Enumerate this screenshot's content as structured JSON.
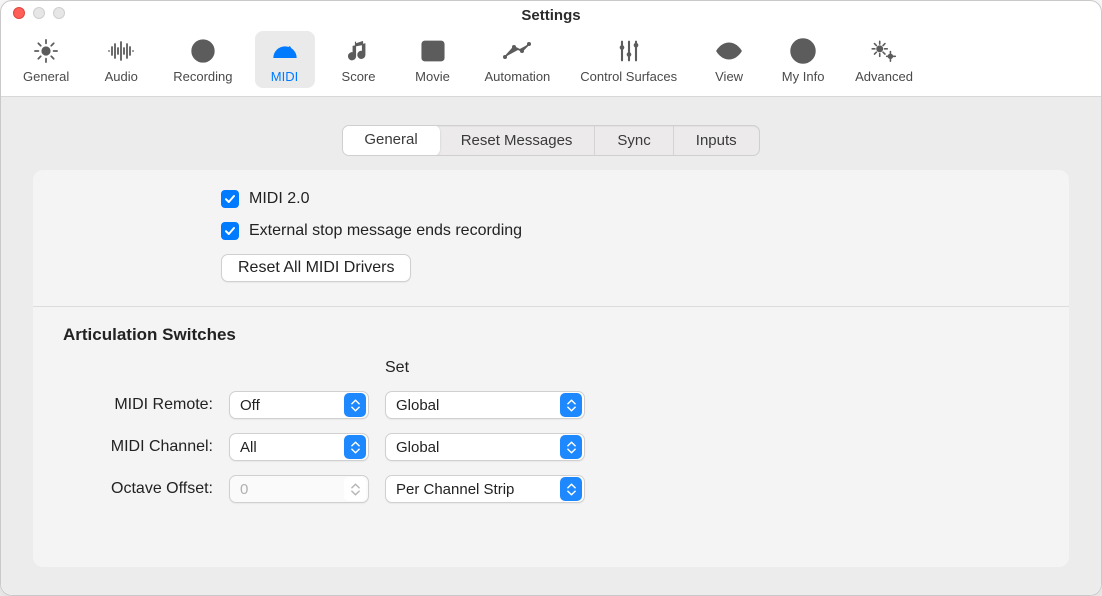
{
  "window": {
    "title": "Settings"
  },
  "toolbar": {
    "items": [
      {
        "id": "general",
        "label": "General",
        "selected": false,
        "icon": "gear"
      },
      {
        "id": "audio",
        "label": "Audio",
        "selected": false,
        "icon": "waveform"
      },
      {
        "id": "recording",
        "label": "Recording",
        "selected": false,
        "icon": "record"
      },
      {
        "id": "midi",
        "label": "MIDI",
        "selected": true,
        "icon": "gauge"
      },
      {
        "id": "score",
        "label": "Score",
        "selected": false,
        "icon": "notes"
      },
      {
        "id": "movie",
        "label": "Movie",
        "selected": false,
        "icon": "film"
      },
      {
        "id": "automation",
        "label": "Automation",
        "selected": false,
        "icon": "curve"
      },
      {
        "id": "control-surfaces",
        "label": "Control Surfaces",
        "selected": false,
        "icon": "sliders"
      },
      {
        "id": "view",
        "label": "View",
        "selected": false,
        "icon": "eye"
      },
      {
        "id": "my-info",
        "label": "My Info",
        "selected": false,
        "icon": "user"
      },
      {
        "id": "advanced",
        "label": "Advanced",
        "selected": false,
        "icon": "gears"
      }
    ]
  },
  "subtabs": {
    "items": [
      {
        "label": "General",
        "active": true
      },
      {
        "label": "Reset Messages",
        "active": false
      },
      {
        "label": "Sync",
        "active": false
      },
      {
        "label": "Inputs",
        "active": false
      }
    ]
  },
  "checkboxes": {
    "midi2": {
      "label": "MIDI 2.0",
      "checked": true
    },
    "externalStop": {
      "label": "External stop message ends recording",
      "checked": true
    }
  },
  "buttons": {
    "resetDrivers": "Reset All MIDI Drivers"
  },
  "articulation": {
    "title": "Articulation Switches",
    "setHeader": "Set",
    "rows": {
      "midiRemote": {
        "label": "MIDI Remote:",
        "value": "Off",
        "set": "Global",
        "enabled": true
      },
      "midiChannel": {
        "label": "MIDI Channel:",
        "value": "All",
        "set": "Global",
        "enabled": true
      },
      "octaveOffset": {
        "label": "Octave Offset:",
        "value": "0",
        "set": "Per Channel Strip",
        "enabled": false
      }
    }
  }
}
